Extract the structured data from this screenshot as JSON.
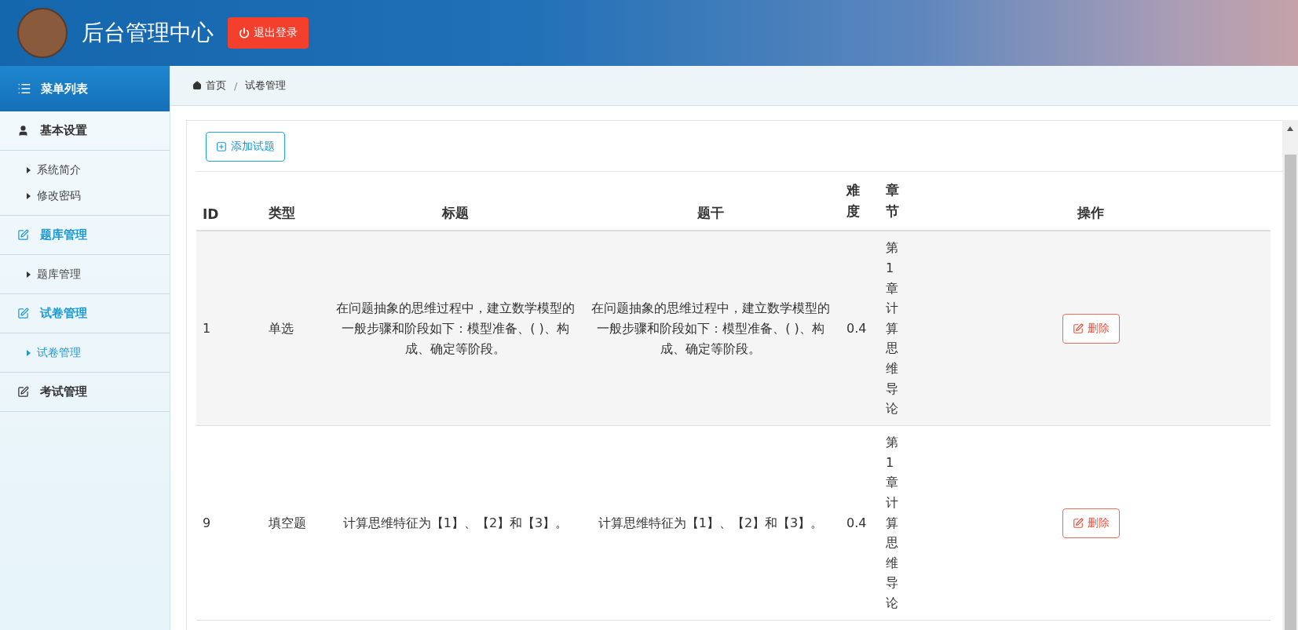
{
  "header": {
    "title": "后台管理中心",
    "logout_button": "退出登录"
  },
  "sidebar": {
    "title": "菜单列表",
    "groups": [
      {
        "label": "基本设置",
        "kind": "user",
        "highlighted": false,
        "children": [
          {
            "label": "系统简介",
            "selected": false
          },
          {
            "label": "修改密码",
            "selected": false
          }
        ]
      },
      {
        "label": "题库管理",
        "kind": "edit",
        "highlighted": true,
        "children": [
          {
            "label": "题库管理",
            "selected": false
          }
        ]
      },
      {
        "label": "试卷管理",
        "kind": "edit",
        "highlighted": true,
        "children": [
          {
            "label": "试卷管理",
            "selected": true
          }
        ]
      },
      {
        "label": "考试管理",
        "kind": "edit",
        "highlighted": false
      }
    ]
  },
  "breadcrumb": {
    "items": [
      "首页",
      "试卷管理"
    ],
    "separator": "/"
  },
  "toolbar": {
    "add_button": "添加试题"
  },
  "table": {
    "columns": [
      "ID",
      "类型",
      "标题",
      "题干",
      "难度",
      "章节",
      "操作"
    ],
    "rows": [
      {
        "cells": [
          "1",
          "单选",
          "在问题抽象的思维过程中，建立数学模型的一般步骤和阶段如下：模型准备、( )、构成、确定等阶段。",
          "在问题抽象的思维过程中，建立数学模型的一般步骤和阶段如下：模型准备、( )、构成、确定等阶段。",
          "0.4",
          "第1章计算思维导论"
        ],
        "action": "删除"
      },
      {
        "cells": [
          "9",
          "填空题",
          "计算思维特征为【1】、【2】和【3】。",
          "计算思维特征为【1】、【2】和【3】。",
          "0.4",
          "第1章计算思维导论"
        ],
        "action": "删除"
      }
    ]
  }
}
